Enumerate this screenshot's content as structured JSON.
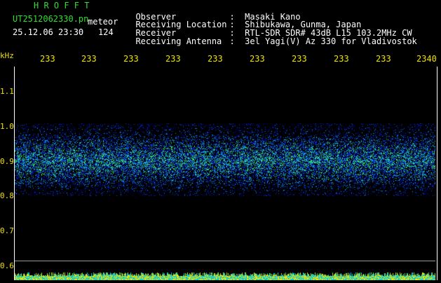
{
  "header": {
    "title": "H R O F F T",
    "filename": "UT2512062330.pn",
    "mode": "meteor",
    "datetime": "25.12.06 23:30",
    "count": "124"
  },
  "info": [
    {
      "label": "Observer",
      "value": ":  Masaki Kano"
    },
    {
      "label": "Receiving Location",
      "value": ":  Shibukawa, Gunma, Japan"
    },
    {
      "label": "Receiver",
      "value": ":  RTL-SDR SDR# 43dB L15 103.2MHz CW"
    },
    {
      "label": "Receiving Antenna",
      "value": ":  3el Yagi(V) Az 330 for Vladivostok"
    }
  ],
  "time_ticks": [
    "233",
    "233",
    "233",
    "233",
    "233",
    "233",
    "233",
    "233",
    "233",
    "2340"
  ],
  "y_axis": {
    "unit": "kHz",
    "labels": [
      "1.1",
      "1.0",
      "0.9",
      "0.8",
      "0.7",
      "0.6"
    ]
  },
  "colors": {
    "title": "#33dd33",
    "labels": "#f0e000",
    "background": "#000000"
  }
}
